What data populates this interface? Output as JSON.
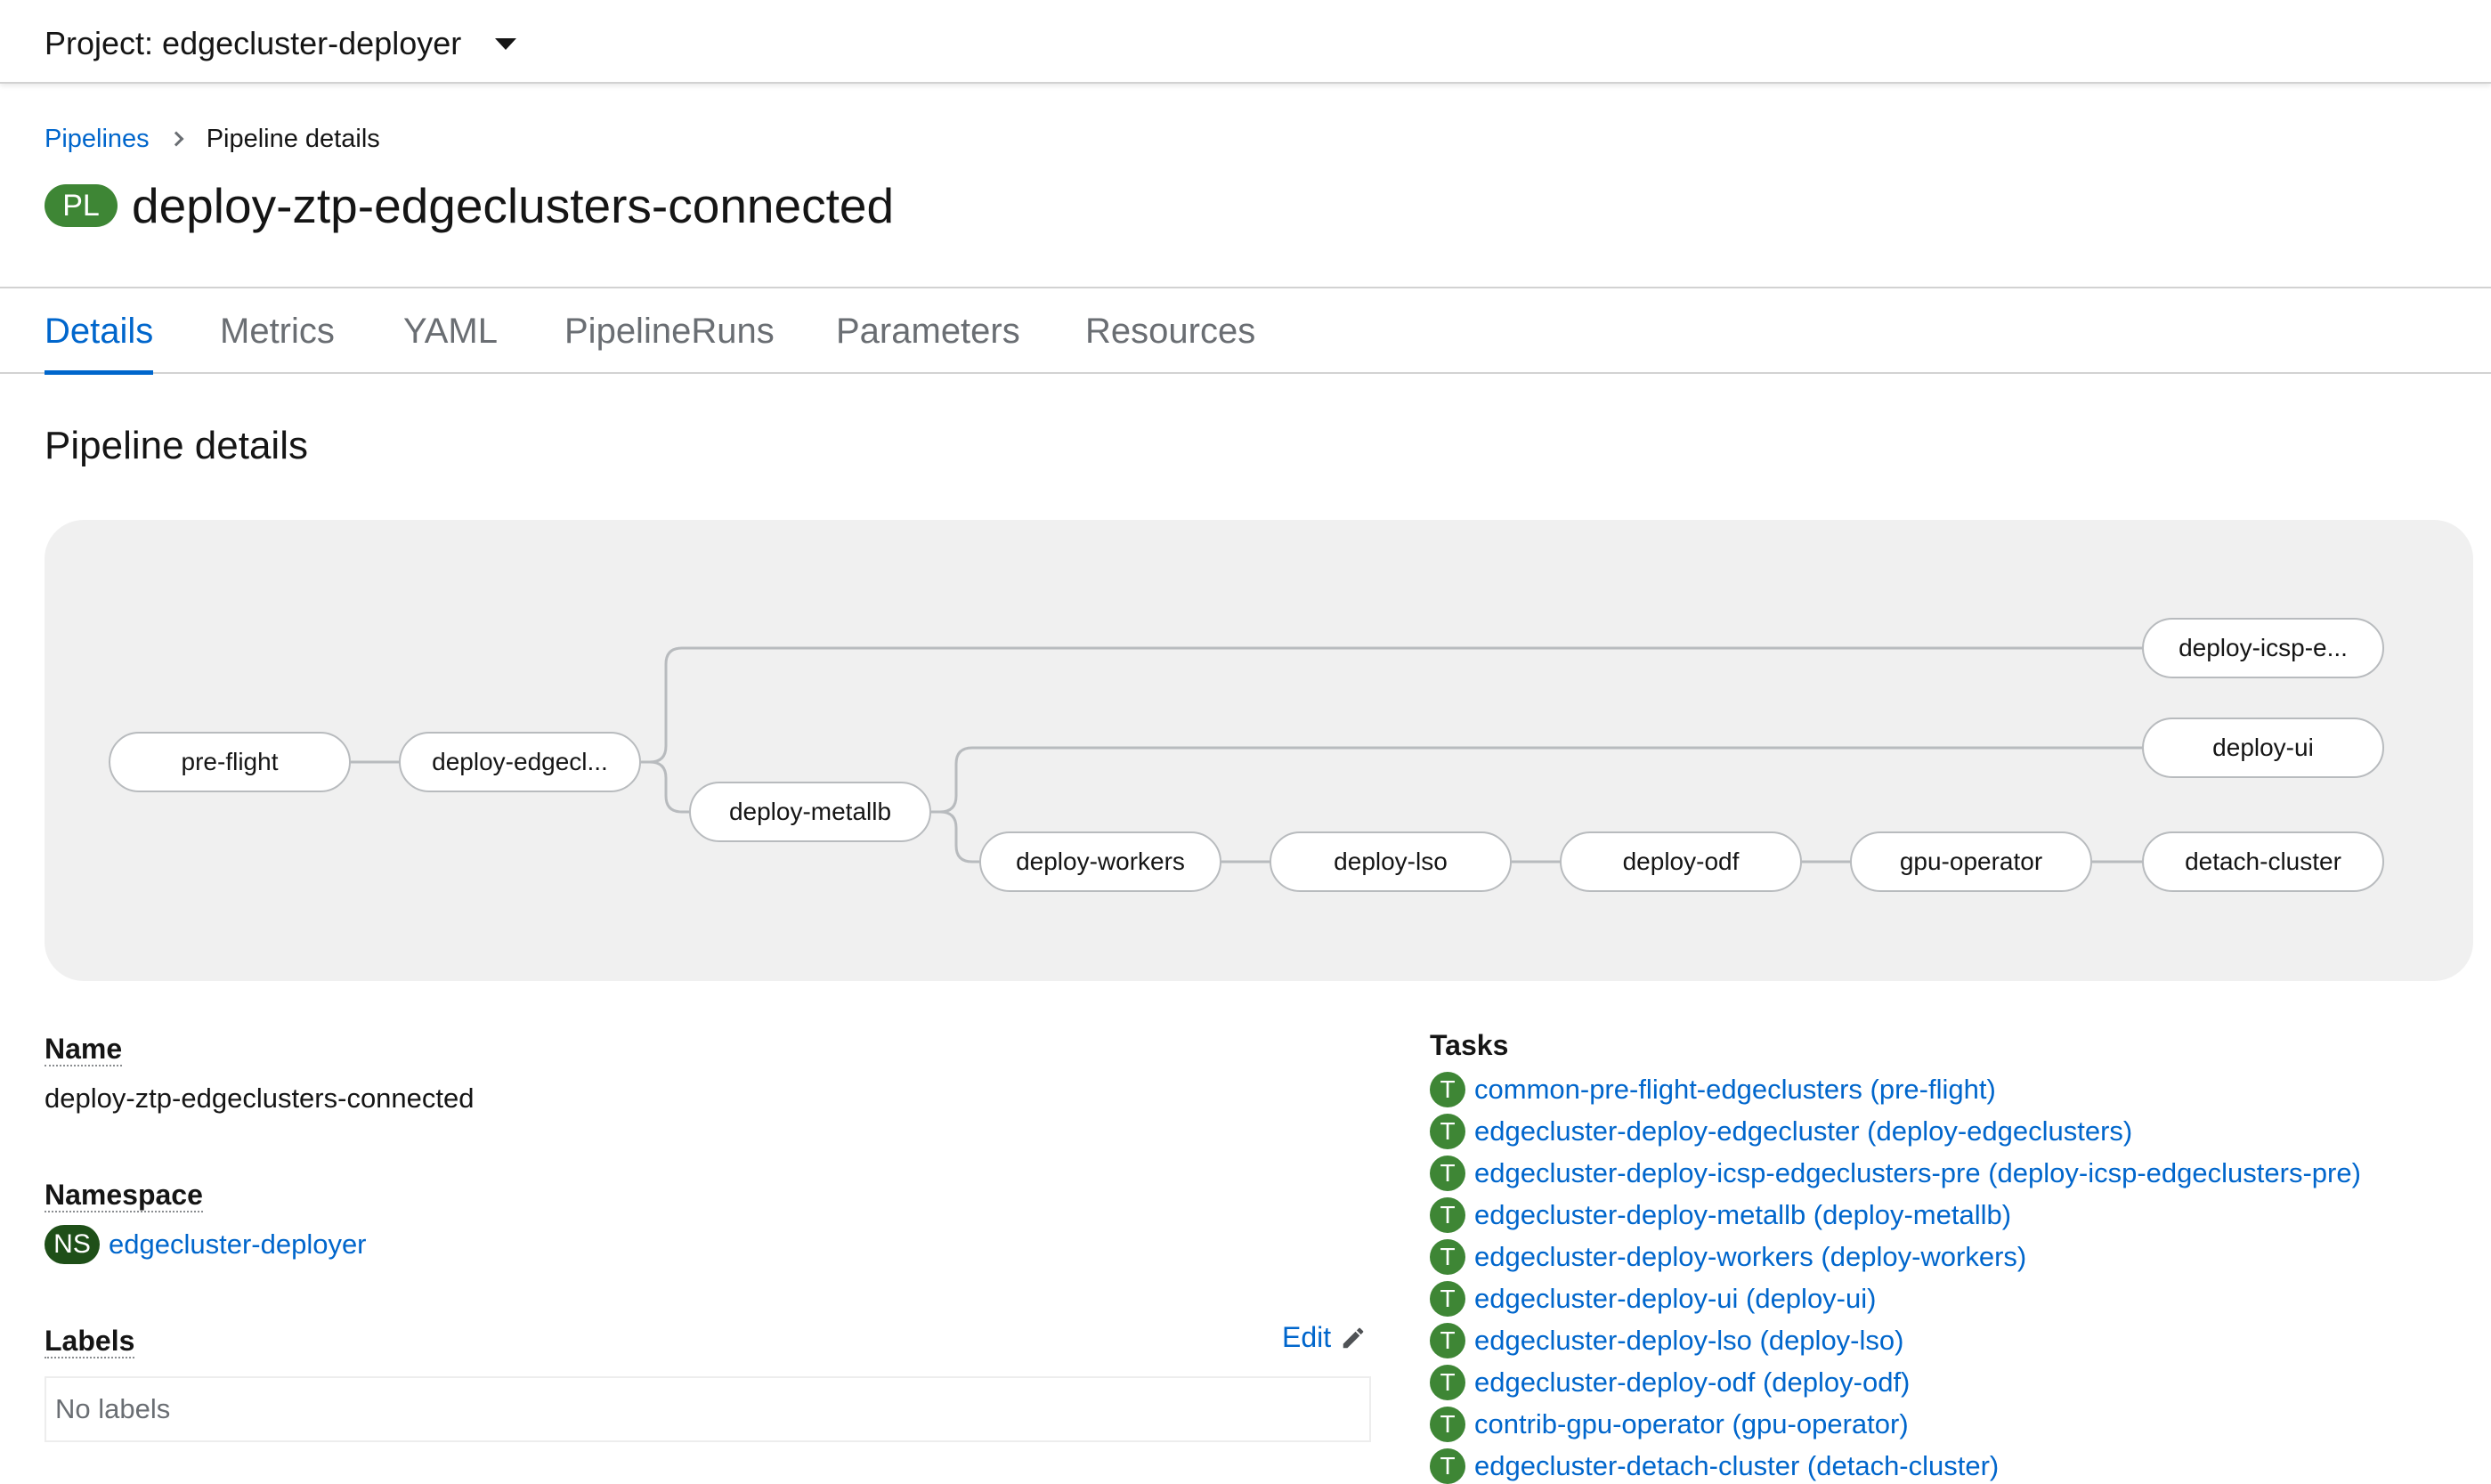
{
  "project_bar": {
    "label": "Project: edgecluster-deployer"
  },
  "breadcrumb": {
    "parent": "Pipelines",
    "current": "Pipeline details"
  },
  "header": {
    "badge": "PL",
    "title": "deploy-ztp-edgeclusters-connected"
  },
  "tabs": [
    {
      "label": "Details",
      "active": true
    },
    {
      "label": "Metrics",
      "active": false
    },
    {
      "label": "YAML",
      "active": false
    },
    {
      "label": "PipelineRuns",
      "active": false
    },
    {
      "label": "Parameters",
      "active": false
    },
    {
      "label": "Resources",
      "active": false
    }
  ],
  "section_title": "Pipeline details",
  "graph": {
    "nodes": [
      {
        "id": "pre-flight",
        "label": "pre-flight"
      },
      {
        "id": "deploy-edgeclusters",
        "label": "deploy-edgecl..."
      },
      {
        "id": "deploy-metallb",
        "label": "deploy-metallb"
      },
      {
        "id": "deploy-icsp",
        "label": "deploy-icsp-e..."
      },
      {
        "id": "deploy-ui",
        "label": "deploy-ui"
      },
      {
        "id": "deploy-workers",
        "label": "deploy-workers"
      },
      {
        "id": "deploy-lso",
        "label": "deploy-lso"
      },
      {
        "id": "deploy-odf",
        "label": "deploy-odf"
      },
      {
        "id": "gpu-operator",
        "label": "gpu-operator"
      },
      {
        "id": "detach-cluster",
        "label": "detach-cluster"
      }
    ]
  },
  "details": {
    "name_label": "Name",
    "name_value": "deploy-ztp-edgeclusters-connected",
    "namespace_label": "Namespace",
    "namespace_badge": "NS",
    "namespace_value": "edgecluster-deployer",
    "labels_label": "Labels",
    "edit_label": "Edit",
    "no_labels": "No labels"
  },
  "tasks": {
    "label": "Tasks",
    "badge": "T",
    "items": [
      "common-pre-flight-edgeclusters (pre-flight)",
      "edgecluster-deploy-edgecluster (deploy-edgeclusters)",
      "edgecluster-deploy-icsp-edgeclusters-pre (deploy-icsp-edgeclusters-pre)",
      "edgecluster-deploy-metallb (deploy-metallb)",
      "edgecluster-deploy-workers (deploy-workers)",
      "edgecluster-deploy-ui (deploy-ui)",
      "edgecluster-deploy-lso (deploy-lso)",
      "edgecluster-deploy-odf (deploy-odf)",
      "contrib-gpu-operator (gpu-operator)",
      "edgecluster-detach-cluster (detach-cluster)"
    ]
  },
  "colors": {
    "link": "#0066cc",
    "badge_green": "#3e8635",
    "badge_ns": "#1e4f18",
    "graph_bg": "#f0f0f0"
  }
}
